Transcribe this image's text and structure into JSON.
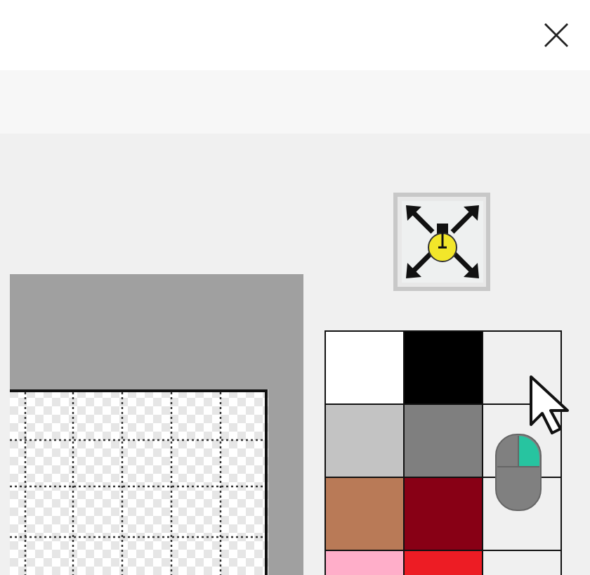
{
  "palette": [
    {
      "kind": "swatch",
      "color": "#ffffff"
    },
    {
      "kind": "swatch",
      "color": "#000000"
    },
    {
      "kind": "empty"
    },
    {
      "kind": "swatch",
      "color": "#c3c3c3"
    },
    {
      "kind": "swatch",
      "color": "#7f7f7f"
    },
    {
      "kind": "empty"
    },
    {
      "kind": "swatch",
      "color": "#b97a57"
    },
    {
      "kind": "swatch",
      "color": "#880015"
    },
    {
      "kind": "empty"
    },
    {
      "kind": "swatch",
      "color": "#ffaec9"
    },
    {
      "kind": "swatch",
      "color": "#ed1c24"
    },
    {
      "kind": "empty"
    }
  ]
}
